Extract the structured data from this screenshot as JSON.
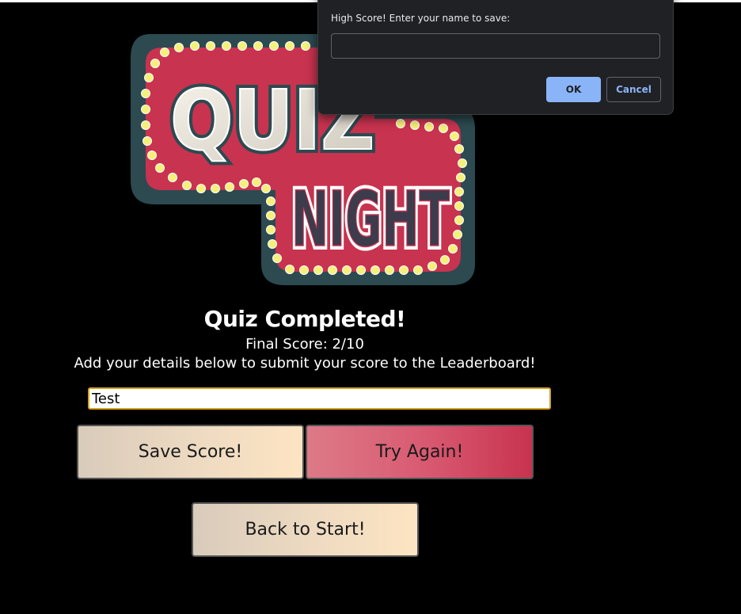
{
  "logo": {
    "word1": "QUIZ",
    "word2": "NIGHT"
  },
  "result": {
    "heading": "Quiz Completed!",
    "final_score": "Final Score: 2/10",
    "instructions": "Add your details below to submit your score to the Leaderboard!"
  },
  "name_input": {
    "value": "Test"
  },
  "buttons": {
    "save": "Save Score!",
    "try_again": "Try Again!",
    "back": "Back to Start!"
  },
  "dialog": {
    "message": "High Score! Enter your name to save:",
    "input_value": "",
    "ok": "OK",
    "cancel": "Cancel"
  },
  "colors": {
    "background": "#000000",
    "input_focus_border": "#d4a21a",
    "cream_button": "#f0dcc2",
    "red_button": "#d85870",
    "dialog_background": "#202124",
    "dialog_accent": "#8ab4f8",
    "logo_pink": "#c8334f",
    "logo_teal": "#2c4a50",
    "bulb_yellow": "#f4f07a"
  }
}
